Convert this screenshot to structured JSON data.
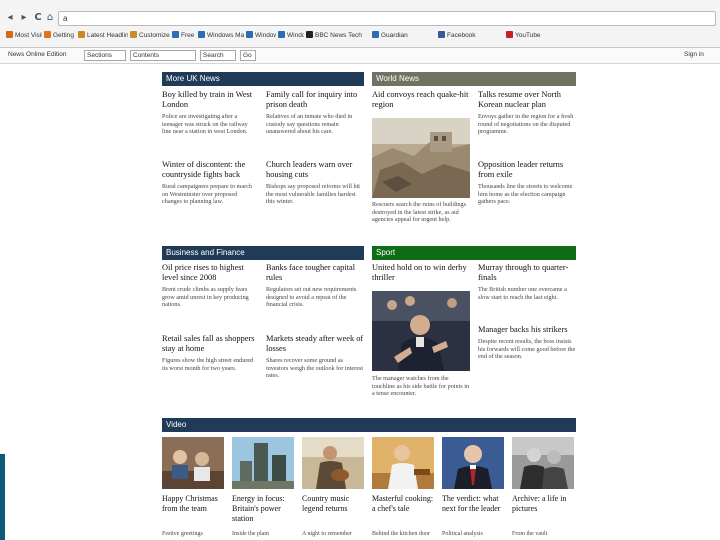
{
  "browser": {
    "url": "a",
    "back_glyph": "◂",
    "forward_glyph": "▸",
    "reload_glyph": "C",
    "home_glyph": "⌂",
    "bookmarks": [
      {
        "label": "Most Visited",
        "color": "#d46a1a"
      },
      {
        "label": "Getting Started",
        "color": "#e2731c"
      },
      {
        "label": "Latest Headlines",
        "color": "#d0851f"
      },
      {
        "label": "Customize Links",
        "color": "#c88d2c"
      },
      {
        "label": "Free Hotmail",
        "color": "#2a6fb4"
      },
      {
        "label": "Windows Marketplace",
        "color": "#2a6fb4"
      },
      {
        "label": "Windows Media",
        "color": "#2a6fb4"
      },
      {
        "label": "Windows",
        "color": "#2a6fb4"
      },
      {
        "label": "BBC News Tech",
        "color": "#222222"
      },
      {
        "label": "Guardian",
        "color": "#2a6fb4"
      },
      {
        "label": "Facebook",
        "color": "#3b5998"
      },
      {
        "label": "YouTube",
        "color": "#cc1f1f"
      }
    ]
  },
  "toolbar": {
    "left_text": "News Online Edition",
    "box_a": "Sections",
    "box_b": "Contents",
    "box_c": "Search",
    "box_d": "Go",
    "right_text": "Sign in"
  },
  "sections": {
    "uk_news": {
      "title": "More UK News",
      "stories": [
        {
          "headline": "Boy killed by train in West London",
          "summary": "Police are investigating after a teenager was struck on the railway line near a station in west London."
        },
        {
          "headline": "Family call for inquiry into prison death",
          "summary": "Relatives of an inmate who died in custody say questions remain unanswered about his care."
        },
        {
          "headline": "Winter of discontent: the countryside fights back",
          "summary": "Rural campaigners prepare to march on Westminster over proposed changes to planning law."
        },
        {
          "headline": "Church leaders warn over housing cuts",
          "summary": "Bishops say proposed reforms will hit the most vulnerable families hardest this winter."
        }
      ]
    },
    "world_news": {
      "title": "World News",
      "stories": [
        {
          "headline": "Aid convoys reach quake-hit region",
          "summary": ""
        },
        {
          "headline": "Talks resume over North Korean nuclear plan",
          "summary": "Envoys gather in the region for a fresh round of negotiations on the disputed programme."
        },
        {
          "headline": "Opposition leader returns from exile",
          "summary": "Thousands line the streets to welcome him home as the election campaign gathers pace."
        }
      ],
      "photo_caption": "Rescuers search the ruins of buildings destroyed in the latest strike, as aid agencies appeal for urgent help."
    },
    "business": {
      "title": "Business and Finance",
      "stories": [
        {
          "headline": "Oil price rises to highest level since 2008",
          "summary": "Brent crude climbs as supply fears grow amid unrest in key producing nations."
        },
        {
          "headline": "Banks face tougher capital rules",
          "summary": "Regulators set out new requirements designed to avoid a repeat of the financial crisis."
        },
        {
          "headline": "Retail sales fall as shoppers stay at home",
          "summary": "Figures show the high street endured its worst month for two years."
        },
        {
          "headline": "Markets steady after week of losses",
          "summary": "Shares recover some ground as investors weigh the outlook for interest rates."
        }
      ]
    },
    "sport": {
      "title": "Sport",
      "stories": [
        {
          "headline": "United hold on to win derby thriller",
          "summary": ""
        },
        {
          "headline": "Murray through to quarter-finals",
          "summary": "The British number one overcame a slow start to reach the last eight."
        },
        {
          "headline": "Manager backs his strikers",
          "summary": "Despite recent results, the boss insists his forwards will come good before the end of the season."
        }
      ],
      "photo_caption": "The manager watches from the touchline as his side battle for points in a tense encounter."
    },
    "video": {
      "title": "Video",
      "items": [
        {
          "headline": "Happy Christmas from the team",
          "sub": "Festive greetings"
        },
        {
          "headline": "Energy in focus: Britain's power station",
          "sub": "Inside the plant"
        },
        {
          "headline": "Country music legend returns",
          "sub": "A night to remember"
        },
        {
          "headline": "Masterful cooking: a chef's tale",
          "sub": "Behind the kitchen door"
        },
        {
          "headline": "The verdict: what next for the leader",
          "sub": "Political analysis"
        },
        {
          "headline": "Archive: a life in pictures",
          "sub": "From the vault"
        }
      ]
    }
  }
}
